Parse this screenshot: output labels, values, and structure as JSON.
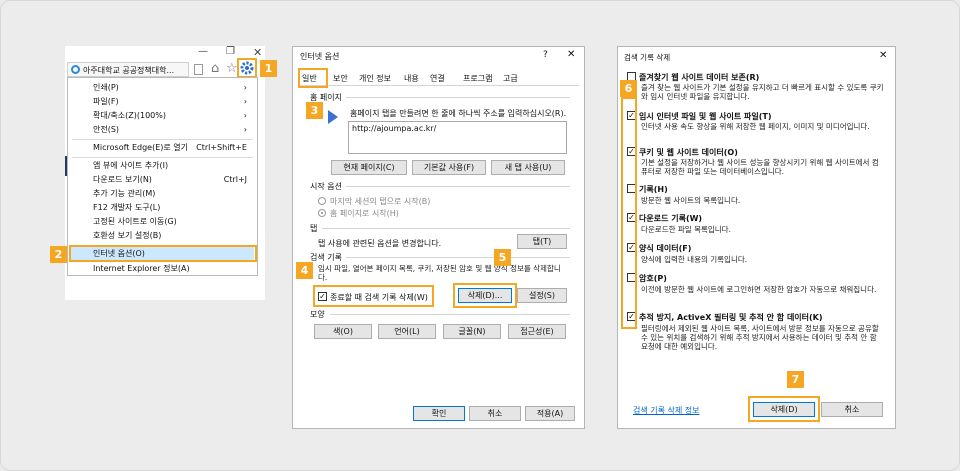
{
  "ie": {
    "tab_title": "아주대학교 공공정책대학...",
    "window_controls": [
      "—",
      "❐",
      "✕"
    ],
    "menu": [
      {
        "label": "인쇄(P)",
        "arrow": "›"
      },
      {
        "label": "파일(F)",
        "arrow": "›"
      },
      {
        "label": "확대/축소(Z)(100%)",
        "arrow": "›"
      },
      {
        "label": "안전(S)",
        "arrow": "›"
      },
      {
        "label": "Microsoft Edge(E)로 열기",
        "shortcut": "Ctrl+Shift+E"
      },
      {
        "label": "앱 뷰에 사이트 추가(I)"
      },
      {
        "label": "다운로드 보기(N)",
        "shortcut": "Ctrl+J"
      },
      {
        "label": "추가 기능 관리(M)"
      },
      {
        "label": "F12 개발자 도구(L)"
      },
      {
        "label": "고정된 사이트로 이동(G)"
      },
      {
        "label": "호환성 보기 설정(B)"
      },
      {
        "label": "인터넷 옵션(O)"
      },
      {
        "label": "Internet Explorer 정보(A)"
      }
    ]
  },
  "badges": [
    "1",
    "2",
    "3",
    "4",
    "5",
    "6",
    "7"
  ],
  "options": {
    "title": "인터넷 옵션",
    "help": "?",
    "close": "✕",
    "tabs": [
      "일반",
      "보안",
      "개인 정보",
      "내용",
      "연결",
      "프로그램",
      "고급"
    ],
    "home_group": "홈 페이지",
    "home_desc": "홈페이지 탭을 만들려면 한 줄에 하나씩 주소를 입력하십시오(R).",
    "home_url": "http://ajoumpa.ac.kr/",
    "home_buttons": [
      "현재 페이지(C)",
      "기본값 사용(F)",
      "새 탭 사용(U)"
    ],
    "startup_group": "시작 옵션",
    "startup_opts": [
      "마지막 세션의 탭으로 시작(B)",
      "홈 페이지로 시작(H)"
    ],
    "tabs_group": "탭",
    "tabs_desc": "탭 사용에 관련된 옵션을 변경합니다.",
    "tabs_button": "탭(T)",
    "history_group": "검색 기록",
    "history_desc": "임시 파일, 열어본 페이지 목록, 쿠키, 저장된 암호 및 웹 양식 정보를 삭제합니다.",
    "history_checkbox": "종료할 때 검색 기록 삭제(W)",
    "history_delete": "삭제(D)...",
    "history_settings": "설정(S)",
    "appearance_group": "모양",
    "appearance_buttons": [
      "색(O)",
      "언어(L)",
      "글꼴(N)",
      "접근성(E)"
    ],
    "footer_buttons": [
      "확인",
      "취소",
      "적용(A)"
    ]
  },
  "del": {
    "title": "검색 기록 삭제",
    "close": "✕",
    "items": [
      {
        "label": "즐겨찾기 웹 사이트 데이터 보존(R)",
        "desc": "즐겨 찾는 웹 사이트가 기본 설정을 유지하고 더 빠르게 표시할 수 있도록 쿠키와 임시 인터넷 파일을 유지합니다.",
        "checked": false
      },
      {
        "label": "임시 인터넷 파일 및 웹 사이트 파일(T)",
        "desc": "인터넷 사용 속도 향상을 위해 저장한 웹 페이지, 이미지 및 미디어입니다.",
        "checked": true
      },
      {
        "label": "쿠키 및 웹 사이트 데이터(O)",
        "desc": "기본 설정을 저장하거나 웹 사이트 성능을 향상시키기 위해 웹 사이트에서 컴퓨터로 저장한 파일 또는 데이터베이스입니다.",
        "checked": true
      },
      {
        "label": "기록(H)",
        "desc": "방문한 웹 사이트의 목록입니다.",
        "checked": false
      },
      {
        "label": "다운로드 기록(W)",
        "desc": "다운로드한 파일 목록입니다.",
        "checked": true
      },
      {
        "label": "양식 데이터(F)",
        "desc": "양식에 입력한 내용의 기록입니다.",
        "checked": true
      },
      {
        "label": "암호(P)",
        "desc": "이전에 방문한 웹 사이트에 로그인하면 저장한 암호가 자동으로 채워집니다.",
        "checked": false
      },
      {
        "label": "추적 방지, ActiveX 필터링 및 추적 안 함 데이터(K)",
        "desc": "필터링에서 제외된 웹 사이트 목록, 사이트에서 방문 정보를 자동으로 공유할 수 있는 위치를 검색하기 위해 추적 방지에서 사용하는 데이터 및 추적 안 함 요청에 대한 예외입니다.",
        "checked": true
      }
    ],
    "link": "검색 기록 삭제 정보",
    "delete_button": "삭제(D)",
    "cancel_button": "취소"
  },
  "colors": {
    "accent": "#f5a623",
    "link": "#0066cc",
    "focus": "#0078d7",
    "highlight": "#cce8ff"
  }
}
